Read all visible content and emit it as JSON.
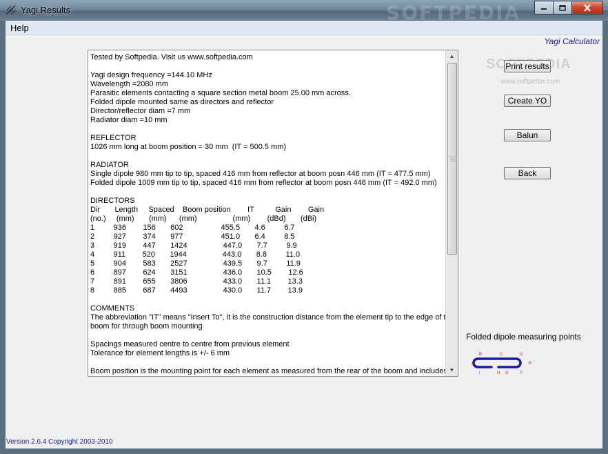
{
  "window": {
    "title": "Yagi Results",
    "watermark": "SOFTPEDIA"
  },
  "menu": {
    "help": "Help"
  },
  "app_title": "Yagi Calculator",
  "buttons": {
    "print_results": "Print results",
    "create_yo": "Create YO",
    "balun": "Balun",
    "back": "Back"
  },
  "softpedia": {
    "logo": "SOFTPEDIA",
    "url": "www.softpedia.com"
  },
  "results_lines": [
    "Tested by Softpedia. Visit us www.softpedia.com",
    "",
    "Yagi design frequency =144.10 MHz",
    "Wavelength =2080 mm",
    "Parasitic elements contacting a square section metal boom 25.00 mm across.",
    "Folded dipole mounted same as directors and reflector",
    "Director/reflector diam =7 mm",
    "Radiator diam =10 mm",
    "",
    "REFLECTOR",
    "1026 mm long at boom position = 30 mm  (IT = 500.5 mm)",
    "",
    "RADIATOR",
    "Single dipole 980 mm tip to tip, spaced 416 mm from reflector at boom posn 446 mm (IT = 477.5 mm)",
    "Folded dipole 1009 mm tip to tip, spaced 416 mm from reflector at boom posn 446 mm (IT = 492.0 mm)",
    "",
    "DIRECTORS",
    "Dir       Length     Spaced    Boom position        IT          Gain        Gain",
    "(no.)     (mm)       (mm)      (mm)                 (mm)        (dBd)       (dBi)",
    "1         936        156       602                  455.5       4.6         6.7",
    "2         927        374       977                  451.0       6.4         8.5",
    "3         919        447       1424                 447.0       7.7         9.9",
    "4         911        520       1944                 443.0       8.8         11.0",
    "5         904        583       2527                 439.5       9.7         11.9",
    "6         897        624       3151                 436.0       10.5        12.6",
    "7         891        655       3806                 433.0       11.1        13.3",
    "8         885        687       4493                 430.0       11.7        13.9",
    "",
    "COMMENTS",
    "The abbreviation \"IT\" means \"Insert To\", it is the construction distance from the element tip to the edge of the",
    "boom for through boom mounting",
    "",
    "Spacings measured centre to centre from previous element",
    "Tolerance for element lengths is +/- 6 mm",
    "",
    "Boom position is the mounting point for each element as measured from the rear of the boom and includes the"
  ],
  "dipole": {
    "label": "Folded dipole measuring points",
    "points": [
      "A",
      "B",
      "C",
      "D",
      "E",
      "F",
      "G",
      "H",
      "I"
    ],
    "stroke_color": "#1a1aa0",
    "point_color": "#c0202a"
  },
  "footer": {
    "version": "Version 2.6.4 Copyright 2003-2010"
  },
  "icons": {
    "minimize": "minimize-icon",
    "maximize": "maximize-icon",
    "close": "close-icon"
  }
}
